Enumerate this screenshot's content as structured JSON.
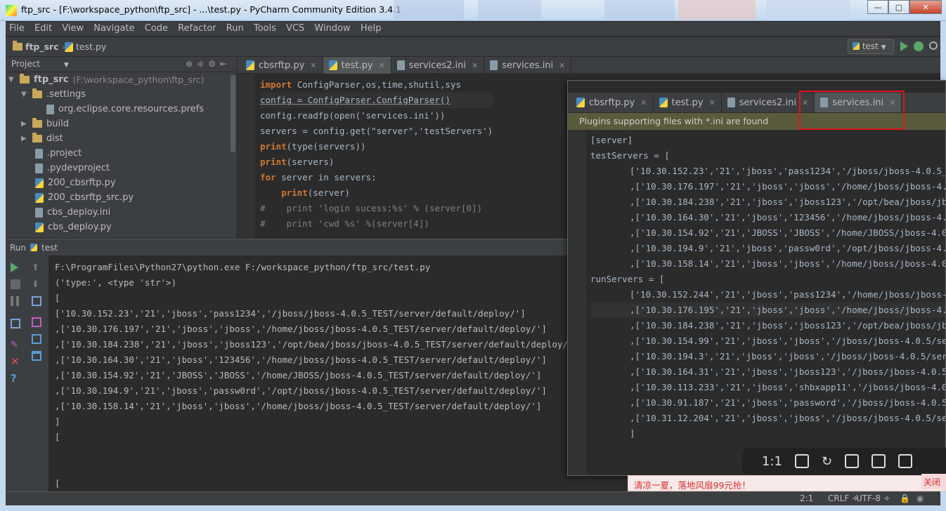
{
  "window": {
    "title": "ftp_src - [F:\\workspace_python\\ftp_src] - ...\\test.py - PyCharm Community Edition 3.4.1",
    "controls": [
      "minimize-icon",
      "maximize-icon",
      "close-icon"
    ]
  },
  "menu": [
    "File",
    "Edit",
    "View",
    "Navigate",
    "Code",
    "Refactor",
    "Run",
    "Tools",
    "VCS",
    "Window",
    "Help"
  ],
  "breadcrumb": {
    "project": "ftp_src",
    "file": "test.py"
  },
  "run_config": {
    "label": "test"
  },
  "project_panel": {
    "title": "Project",
    "root_name": "ftp_src",
    "root_path": "(F:\\workspace_python\\ftp_src)",
    "items": [
      {
        "label": ".settings"
      },
      {
        "label": "org.eclipse.core.resources.prefs"
      },
      {
        "label": "build"
      },
      {
        "label": "dist"
      },
      {
        "label": ".project"
      },
      {
        "label": ".pydevproject"
      },
      {
        "label": "200_cbsrftp.py"
      },
      {
        "label": "200_cbsrftp_src.py"
      },
      {
        "label": "cbs_deploy.ini"
      },
      {
        "label": "cbs_deploy.py"
      }
    ]
  },
  "editor_tabs": [
    {
      "label": "cbsrftp.py"
    },
    {
      "label": "test.py"
    },
    {
      "label": "services2.ini"
    },
    {
      "label": "services.ini"
    }
  ],
  "code_lines": [
    "import ConfigParser,os,time,shutil,sys",
    "config = ConfigParser.ConfigParser()",
    "config.readfp(open('services.ini'))",
    "servers = config.get(\"server\",'testServers')",
    "print(type(servers))",
    "print(servers)",
    "for server in servers:",
    "    print(server)",
    "#    print 'login sucess;%s' % (server[0])",
    "#    print 'cwd %s' %(server[4])"
  ],
  "run_panel": {
    "label": "Run",
    "config": "test"
  },
  "console_lines": [
    "F:\\ProgramFiles\\Python27\\python.exe F:/workspace_python/ftp_src/test.py",
    "('type:', <type 'str'>)",
    "[",
    "['10.30.152.23','21','jboss','pass1234','/jboss/jboss-4.0.5_TEST/server/default/deploy/']",
    ",['10.30.176.197','21','jboss','jboss','/home/jboss/jboss-4.0.5_TEST/server/default/deploy/']",
    ",['10.30.184.238','21','jboss','jboss123','/opt/bea/jboss/jboss-4.0.5_TEST/server/default/deploy/']",
    ",['10.30.164.30','21','jboss','123456','/home/jboss/jboss-4.0.5_TEST/server/default/deploy/']",
    ",['10.30.154.92','21','JBOSS','JBOSS','/home/JBOSS/jboss-4.0.5_TEST/server/default/deploy/']",
    ",['10.30.194.9','21','jboss','passw0rd','/opt/jboss/jboss-4.0.5_TEST/server/default/deploy/']",
    ",['10.30.158.14','21','jboss','jboss','/home/jboss/jboss-4.0.5_TEST/server/default/deploy/']",
    "]",
    "[",
    "",
    "",
    "["
  ],
  "popup": {
    "tabs": [
      {
        "label": "cbsrftp.py"
      },
      {
        "label": "test.py"
      },
      {
        "label": "services2.ini"
      },
      {
        "label": "services.ini"
      }
    ],
    "notice": "Plugins supporting files with *.ini are found",
    "lines": [
      "[server]",
      "testServers = [",
      "['10.30.152.23','21','jboss','pass1234','/jboss/jboss-4.0.5_TEST/",
      ",['10.30.176.197','21','jboss','jboss','/home/jboss/jboss-4.0.5_T",
      ",['10.30.184.238','21','jboss','jboss123','/opt/bea/jboss/jboss-4",
      ",['10.30.164.30','21','jboss','123456','/home/jboss/jboss-4.0.5_T",
      ",['10.30.154.92','21','JBOSS','JBOSS','/home/JBOSS/jboss-4.0.5_TE",
      ",['10.30.194.9','21','jboss','passw0rd','/opt/jboss/jboss-4.0.5_T",
      ",['10.30.158.14','21','jboss','jboss','/home/jboss/jboss-4.0.5_TE",
      "runServers = [",
      "['10.30.152.244','21','jboss','pass1234','/home/jboss/jboss-4.0.",
      ",['10.30.176.195','21','jboss','jboss','/home/jboss/jboss-4.0.5/",
      ",['10.30.184.238','21','jboss','jboss123','/opt/bea/jboss/jboss-",
      ",['10.30.154.99','21','jboss','jboss','/jboss/jboss-4.0.5/server/",
      ",['10.30.194.3','21','jboss','jboss','/jboss/jboss-4.0.5/server/c",
      ",['10.30.164.31','21','jboss','jboss123','/jboss/jboss-4.0.5/ser",
      ",['10.30.113.233','21','jboss','shbxapp11','/jboss/jboss-4.0.5/se",
      ",['10.30.91.187','21','jboss','password','/jboss/jboss-4.0.5/ser",
      ",['10.31.12.204','21','jboss','jboss','/jboss/jboss-4.0.5/server/",
      "]"
    ]
  },
  "viewer_toolbar": {
    "ratio": "1:1"
  },
  "ad": {
    "text": "清凉一夏，落地风扇99元抢！",
    "close": "关闭"
  },
  "status": {
    "position": "2:1",
    "line_sep": "CRLF ÷",
    "encoding": "UTF-8 ÷"
  }
}
